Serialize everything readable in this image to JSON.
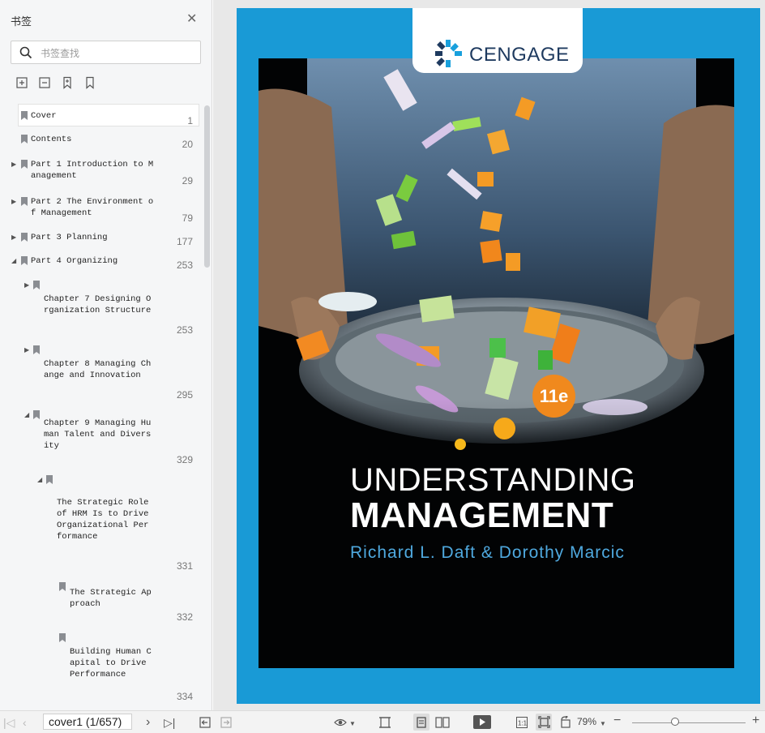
{
  "sidebar": {
    "title": "书签",
    "search_placeholder": "书签查找",
    "items": [
      {
        "title": "Cover",
        "page": "1"
      },
      {
        "title": "Contents",
        "page": "20"
      },
      {
        "title": "Part 1 Introduction to M\nanagement",
        "page": "29"
      },
      {
        "title": "Part 2 The Environment o\nf Management",
        "page": "79"
      },
      {
        "title": "Part 3 Planning",
        "page": "177"
      },
      {
        "title": "Part 4 Organizing",
        "page": "253"
      },
      {
        "title": "Chapter 7 Designing O\nrganization Structure",
        "page": "253"
      },
      {
        "title": "Chapter 8 Managing Ch\nange and Innovation",
        "page": "295"
      },
      {
        "title": "Chapter 9 Managing Hu\nman Talent and Divers\nity",
        "page": "329"
      },
      {
        "title": "The Strategic Role\nof HRM Is to Drive\nOrganizational Per\nformance",
        "page": "331"
      },
      {
        "title": "The Strategic Ap\nproach",
        "page": "332"
      },
      {
        "title": "Building Human C\napital to Drive\nPerformance",
        "page": "334"
      }
    ]
  },
  "cover": {
    "publisher": "CENGAGE",
    "edition": "11e",
    "title_line1": "UNDERSTANDING",
    "title_line2": "MANAGEMENT",
    "authors": "Richard L. Daft & Dorothy Marcic"
  },
  "toolbar": {
    "page_indicator": "cover1 (1/657)",
    "zoom": "79%",
    "zoom_level": 0.38
  },
  "colors": {
    "frame_blue": "#199ad6",
    "badge_orange": "#f0891d",
    "author_blue": "#4fa9df"
  }
}
